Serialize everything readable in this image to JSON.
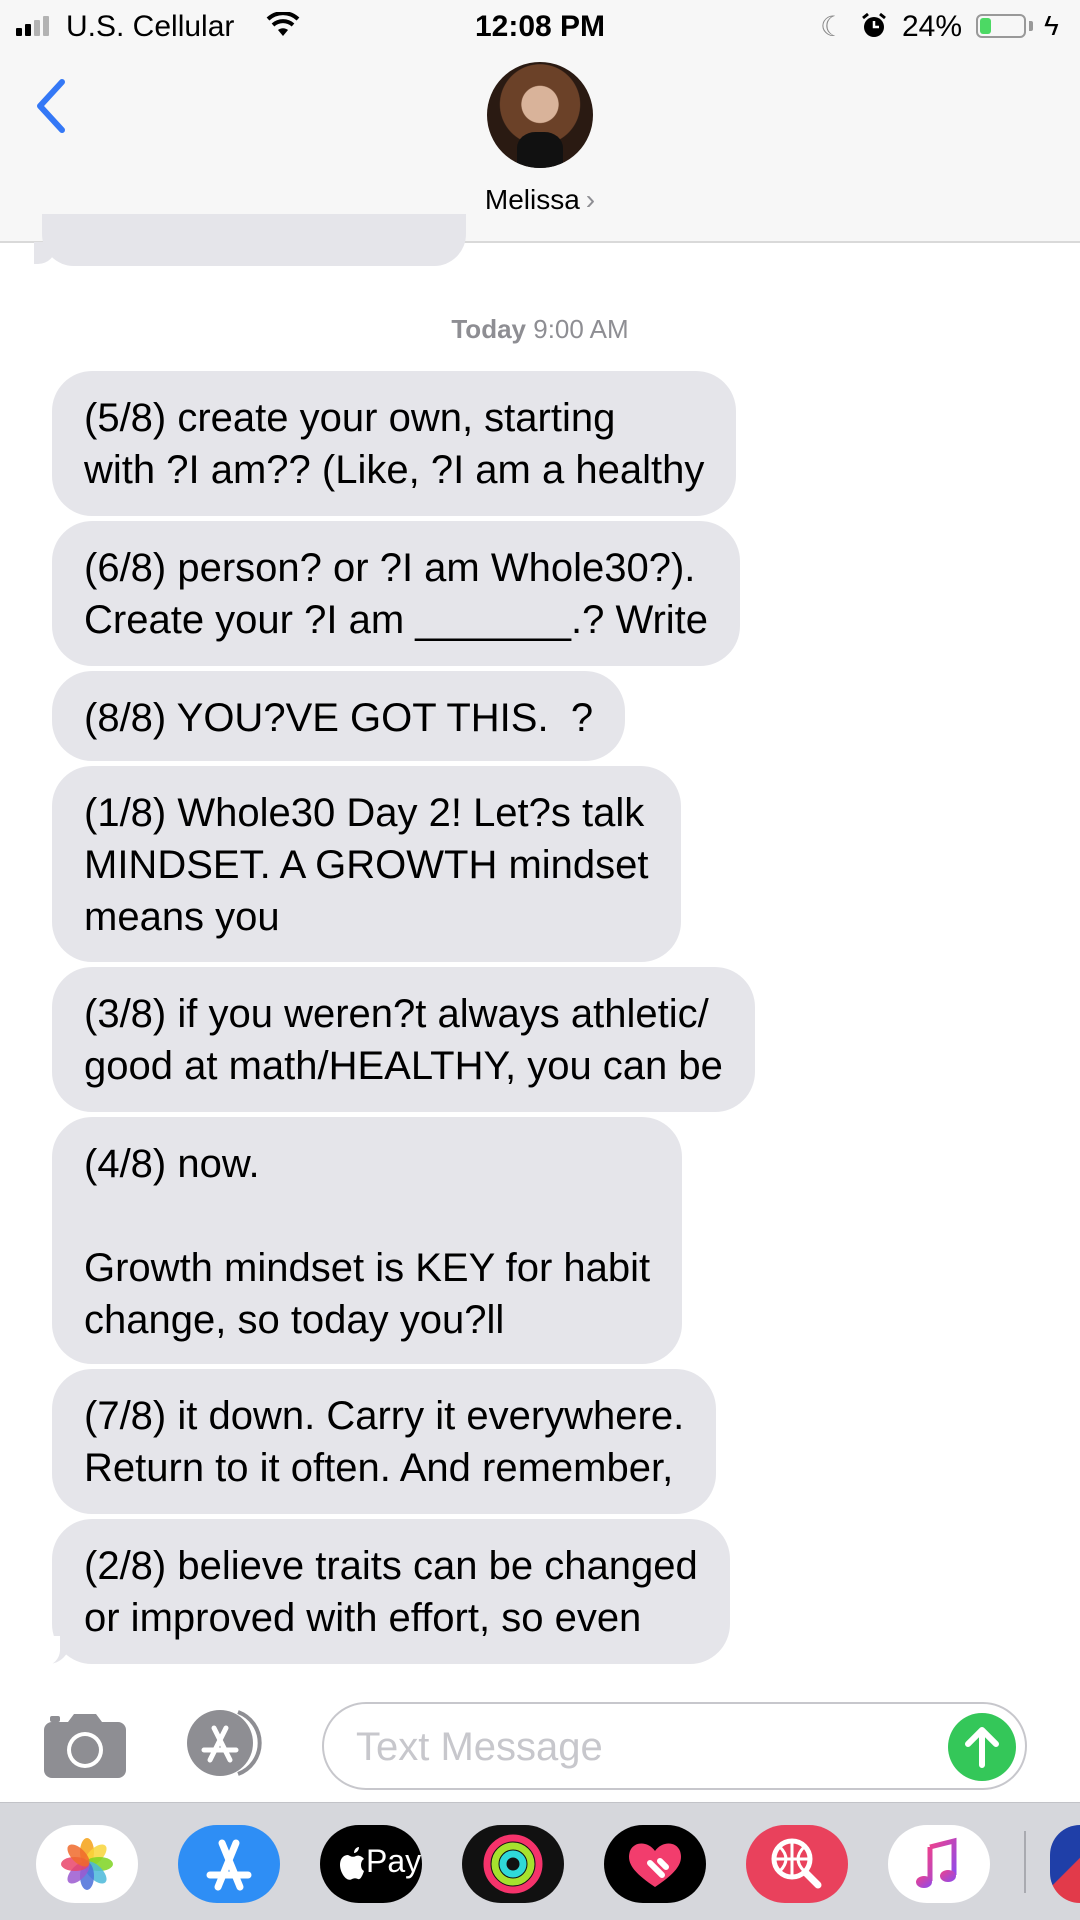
{
  "status_bar": {
    "carrier": "U.S. Cellular",
    "time": "12:08 PM",
    "battery_percent": "24%",
    "battery_level": 0.24,
    "icons": [
      "signal-icon",
      "wifi-icon",
      "do-not-disturb-icon",
      "alarm-icon",
      "battery-icon",
      "charging-icon"
    ]
  },
  "header": {
    "contact_name": "Melissa",
    "chevron": "›",
    "icons": [
      "back-chevron-icon",
      "avatar"
    ]
  },
  "conversation": {
    "timestamp_day": "Today",
    "timestamp_time": "9:00 AM",
    "messages": [
      "(5/8) create your own, starting\nwith ?I am?? (Like, ?I am a healthy",
      "(6/8) person? or ?I am Whole30?).\nCreate your ?I am _______.? Write",
      "(8/8) YOU?VE GOT THIS.  ?",
      "(1/8) Whole30 Day 2! Let?s talk\nMINDSET. A GROWTH mindset\nmeans you",
      "(3/8) if you weren?t always athletic/\ngood at math/HEALTHY, you can be",
      "(4/8) now.\n\nGrowth mindset is KEY for habit\nchange, so today you?ll",
      "(7/8) it down. Carry it everywhere.\nReturn to it often. And remember,",
      "(2/8) believe traits can be changed\nor improved with effort, so even"
    ]
  },
  "composer": {
    "placeholder": "Text Message",
    "value": "",
    "icons": [
      "camera-icon",
      "app-store-icon",
      "send-arrow-icon"
    ]
  },
  "app_drawer": {
    "apps": [
      "Photos",
      "App Store",
      "Apple Pay",
      "Activity",
      "Heart",
      "Search Images",
      "Music"
    ],
    "apple_pay_label": "Pay",
    "accent_colors": {
      "send": "#34c759",
      "back": "#3478f6",
      "bubble": "#e5e5ea"
    }
  }
}
